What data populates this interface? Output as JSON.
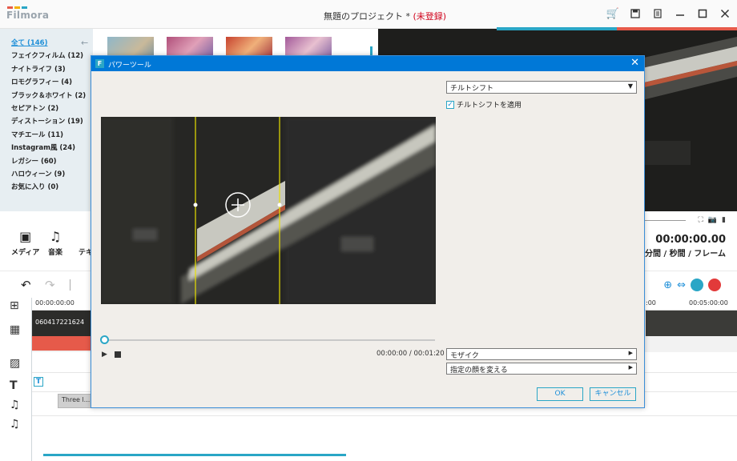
{
  "app": {
    "logo_text": "Filmora",
    "window_title": "無題のプロジェクト * ",
    "unregistered": "(未登録)",
    "title_icons": [
      "cart-icon",
      "save-icon",
      "document-icon",
      "minimize-icon",
      "maximize-icon",
      "close-icon"
    ]
  },
  "sidebar": {
    "items": [
      {
        "label": "全て (146)"
      },
      {
        "label": "フェイクフィルム (12)"
      },
      {
        "label": "ナイトライフ (3)"
      },
      {
        "label": "ロモグラフィー (4)"
      },
      {
        "label": "ブラック＆ホワイト (2)"
      },
      {
        "label": "セピアトン (2)"
      },
      {
        "label": "ディストーション (19)"
      },
      {
        "label": "マチエール (11)"
      },
      {
        "label": "Instagram風 (24)"
      },
      {
        "label": "レガシー (60)"
      },
      {
        "label": "ハロウィーン (9)"
      },
      {
        "label": "お気に入り (0)"
      }
    ]
  },
  "mediabar": {
    "media": "メディア",
    "music": "音楽",
    "text": "テキ"
  },
  "preview": {
    "timecode": "00:00:00.00",
    "time_units": "/ 分間 / 秒間 / フレーム"
  },
  "timeline": {
    "ruler_start": "00:00:00:00",
    "ruler_mid": ":00",
    "ruler_end": "00:05:00:00",
    "video_clip": "060417221624",
    "audio_clip": "Three l..."
  },
  "dialog": {
    "title": "パワーツール",
    "effect_select": "チルトシフト",
    "apply_checkbox": "チルトシフトを適用",
    "apply_checked": true,
    "time_display": "00:00:00 / 00:01:20",
    "section_mosaic": "モザイク",
    "section_face": "指定の顔を変える",
    "ok": "OK",
    "cancel": "キャンセル"
  },
  "colors": {
    "accent": "#2aa6c6",
    "titlebar_blue": "#0078d7",
    "unregistered_red": "#d0021b",
    "clip_red": "#e65a4a"
  }
}
